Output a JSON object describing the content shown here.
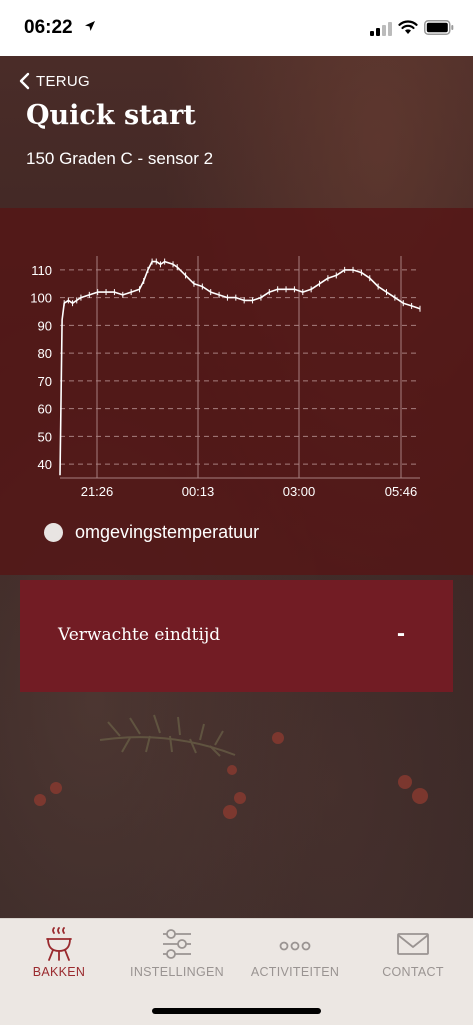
{
  "status_bar": {
    "time": "06:22"
  },
  "header": {
    "back_label": "TERUG",
    "title": "Quick start",
    "subtitle": "150 Graden C - sensor 2"
  },
  "chart_data": {
    "type": "line",
    "y_ticks": [
      "110",
      "100",
      "90",
      "80",
      "70",
      "60",
      "50",
      "40"
    ],
    "y_values": [
      110,
      100,
      90,
      80,
      70,
      60,
      50,
      40
    ],
    "x_ticks": [
      "21:26",
      "00:13",
      "03:00",
      "05:46"
    ],
    "ylim": [
      35,
      115
    ],
    "grid": true,
    "series": [
      {
        "name": "omgevingstemperatuur",
        "color": "#ffffff",
        "points": [
          [
            0,
            36
          ],
          [
            1,
            92
          ],
          [
            2,
            98
          ],
          [
            4,
            99
          ],
          [
            6,
            98
          ],
          [
            8,
            99
          ],
          [
            10,
            100
          ],
          [
            14,
            101
          ],
          [
            18,
            102
          ],
          [
            22,
            102
          ],
          [
            26,
            102
          ],
          [
            30,
            101
          ],
          [
            34,
            102
          ],
          [
            38,
            103
          ],
          [
            40,
            106
          ],
          [
            42,
            110
          ],
          [
            44,
            113
          ],
          [
            46,
            113
          ],
          [
            48,
            112
          ],
          [
            50,
            113
          ],
          [
            54,
            112
          ],
          [
            56,
            111
          ],
          [
            60,
            108
          ],
          [
            64,
            105
          ],
          [
            68,
            104
          ],
          [
            72,
            102
          ],
          [
            76,
            101
          ],
          [
            80,
            100
          ],
          [
            84,
            100
          ],
          [
            88,
            99
          ],
          [
            92,
            99
          ],
          [
            96,
            100
          ],
          [
            100,
            102
          ],
          [
            104,
            103
          ],
          [
            108,
            103
          ],
          [
            112,
            103
          ],
          [
            116,
            102
          ],
          [
            120,
            103
          ],
          [
            124,
            105
          ],
          [
            128,
            107
          ],
          [
            132,
            108
          ],
          [
            136,
            110
          ],
          [
            140,
            110
          ],
          [
            144,
            109
          ],
          [
            148,
            107
          ],
          [
            152,
            104
          ],
          [
            156,
            102
          ],
          [
            160,
            100
          ],
          [
            164,
            98
          ],
          [
            168,
            97
          ],
          [
            172,
            96
          ]
        ]
      }
    ],
    "legend": [
      {
        "label": "omgevingstemperatuur",
        "color": "#e8e4e2"
      }
    ]
  },
  "card": {
    "label": "Verwachte eindtijd",
    "value": "-"
  },
  "tabbar": {
    "tabs": [
      {
        "label": "BAKKEN",
        "icon": "grill-icon",
        "active": true
      },
      {
        "label": "INSTELLINGEN",
        "icon": "sliders-icon",
        "active": false
      },
      {
        "label": "ACTIVITEITEN",
        "icon": "dots-icon",
        "active": false
      },
      {
        "label": "CONTACT",
        "icon": "envelope-icon",
        "active": false
      }
    ]
  },
  "colors": {
    "accent": "#721c24",
    "active_tab": "#9a2a2e",
    "inactive_tab": "#9a9492"
  }
}
